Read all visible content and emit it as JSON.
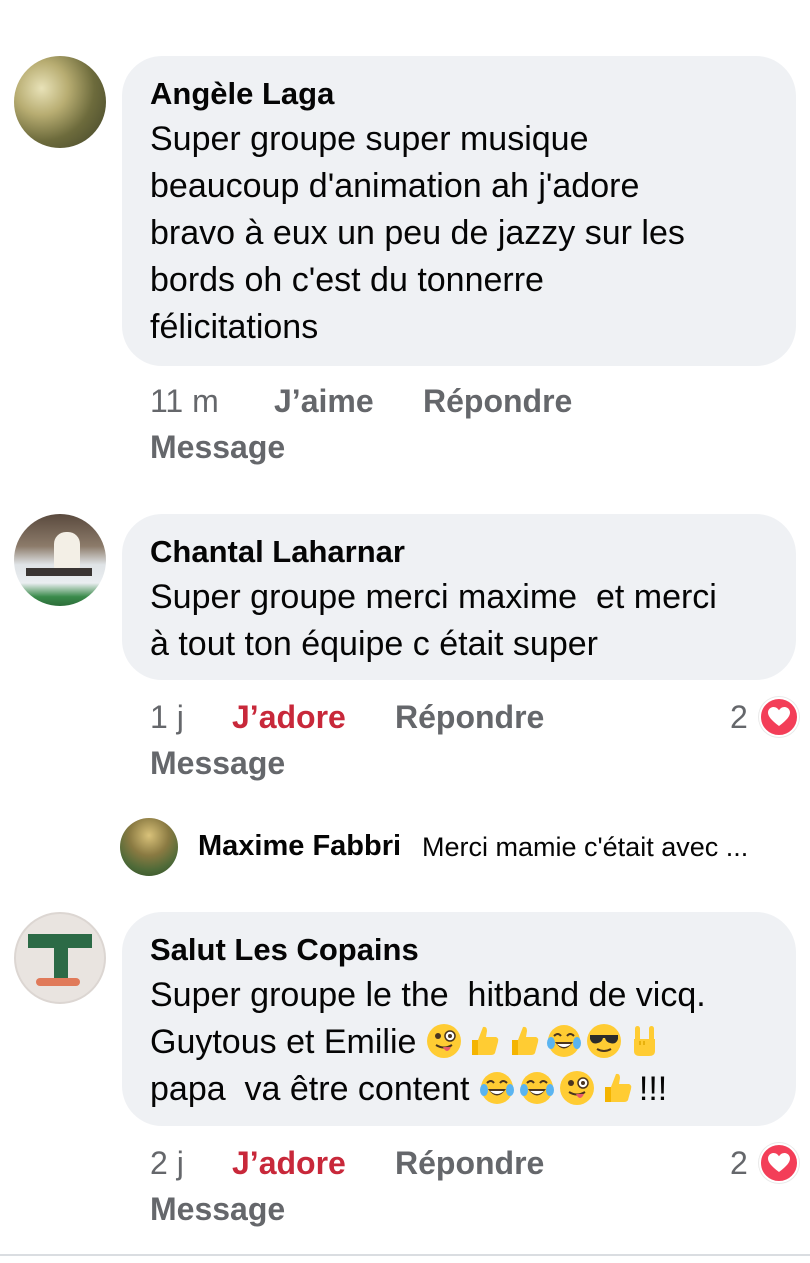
{
  "comments": [
    {
      "author": "Angèle Laga",
      "text": "Super groupe super musique\nbeaucoup d'animation ah j'adore\nbravo à eux un peu de jazzy sur les\nbords oh c'est du tonnerre\nfélicitations",
      "time": "11 m",
      "reaction": "J’aime",
      "reply": "Répondre",
      "message": "Message"
    },
    {
      "author": "Chantal Laharnar",
      "text": "Super groupe merci maxime  et merci\nà tout ton équipe c était super",
      "time": "1 j",
      "reaction": "J’adore",
      "reply": "Répondre",
      "message": "Message",
      "reaction_count": "2"
    },
    {
      "author": "Salut Les Copains",
      "text_line1": "Super groupe le the  hitband de vicq.",
      "text_line2": "Guytous et Emilie",
      "text_line3": "papa  va être content",
      "text_line3_suffix": "!!!",
      "time": "2 j",
      "reaction": "J’adore",
      "reply": "Répondre",
      "message": "Message",
      "reaction_count": "2"
    }
  ],
  "reply_preview": {
    "author": "Maxime Fabbri",
    "text": "Merci mamie c'était avec ..."
  },
  "colors": {
    "bubble": "#eff1f4",
    "love": "#c8283a",
    "meta": "#65676b",
    "heart": "#f33e58"
  },
  "icons": [
    "heart-icon",
    "winking-tongue-emoji",
    "thumbs-up-emoji",
    "laughing-tears-emoji",
    "sunglasses-emoji",
    "rock-hand-emoji"
  ]
}
